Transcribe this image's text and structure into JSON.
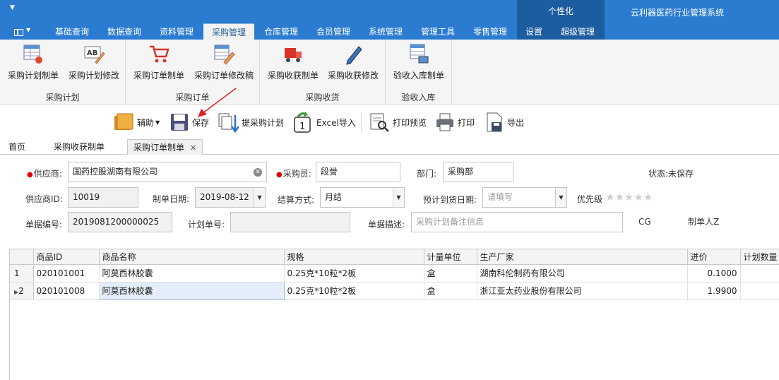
{
  "app_title": "云利器医药行业管理系统",
  "context_group": "个性化",
  "ribbon_tabs": [
    "基础查询",
    "数据查询",
    "资料管理",
    "采购管理",
    "仓库管理",
    "会员管理",
    "系统管理",
    "管理工具",
    "零售管理",
    "设置",
    "超级管理"
  ],
  "ribbon_groups": [
    {
      "label": "采购计划",
      "buttons": [
        {
          "label": "采购计划制单",
          "icon": "plan-sheet-icon"
        },
        {
          "label": "采购计划修改",
          "icon": "ab-edit-icon"
        }
      ]
    },
    {
      "label": "采购订单",
      "buttons": [
        {
          "label": "采购订单制单",
          "icon": "cart-icon"
        },
        {
          "label": "采购订单修改稿",
          "icon": "sheet-edit-icon"
        }
      ]
    },
    {
      "label": "采购收货",
      "buttons": [
        {
          "label": "采购收获制单",
          "icon": "truck-icon"
        },
        {
          "label": "采购收获修改",
          "icon": "pencil-icon"
        }
      ]
    },
    {
      "label": "验收入库",
      "buttons": [
        {
          "label": "验收入库制单",
          "icon": "warehouse-sheet-icon"
        }
      ]
    }
  ],
  "toolbar": {
    "assist": "辅助",
    "save": "保存",
    "fetch_plan": "提采购计划",
    "excel_import": "Excel导入",
    "print_preview": "打印预览",
    "print": "打印",
    "export": "导出"
  },
  "doc_tabs": [
    "首页",
    "采购收获制单",
    "采购订单制单"
  ],
  "form": {
    "supplier_label": "供应商:",
    "supplier_value": "国药控股湖南有限公司",
    "buyer_label": "采购员:",
    "buyer_value": "段誉",
    "dept_label": "部门:",
    "dept_value": "采购部",
    "status_label": "状态:",
    "status_value": "未保存",
    "supplier_id_label": "供应商ID:",
    "supplier_id_value": "10019",
    "date_label": "制单日期:",
    "date_value": "2019-08-12",
    "settle_label": "结算方式:",
    "settle_value": "月结",
    "expected_label": "预计到货日期:",
    "expected_placeholder": "请填写",
    "priority_label": "优先级",
    "priority_stars": 5,
    "priority_value": 0,
    "doc_no_label": "单据编号:",
    "doc_no_value": "2019081200000025",
    "plan_no_label": "计划单号:",
    "plan_no_value": "",
    "desc_label": "单据描述:",
    "desc_placeholder": "采购计划备注信息",
    "cg_text": "CG",
    "creator_text": "制单人Z"
  },
  "grid": {
    "columns": [
      "商品ID",
      "商品名称",
      "规格",
      "计量单位",
      "生产厂家",
      "进价",
      "计划数量"
    ],
    "rows": [
      {
        "no": "1",
        "id": "020101001",
        "name": "阿莫西林胶囊",
        "spec": "0.25克*10粒*2板",
        "unit": "盒",
        "maker": "湖南科伦制药有限公司",
        "price": "0.1000",
        "qty": ""
      },
      {
        "no": "2",
        "id": "020101008",
        "name": "阿莫西林胶囊",
        "spec": "0.25克*10粒*2板",
        "unit": "盒",
        "maker": "浙江亚太药业股份有限公司",
        "price": "1.9900",
        "qty": ""
      }
    ]
  },
  "colors": {
    "titlebar": "#2b7bd1",
    "context": "#1c5d9f",
    "required": "#dd0000",
    "annotation_arrow": "#e02020"
  }
}
